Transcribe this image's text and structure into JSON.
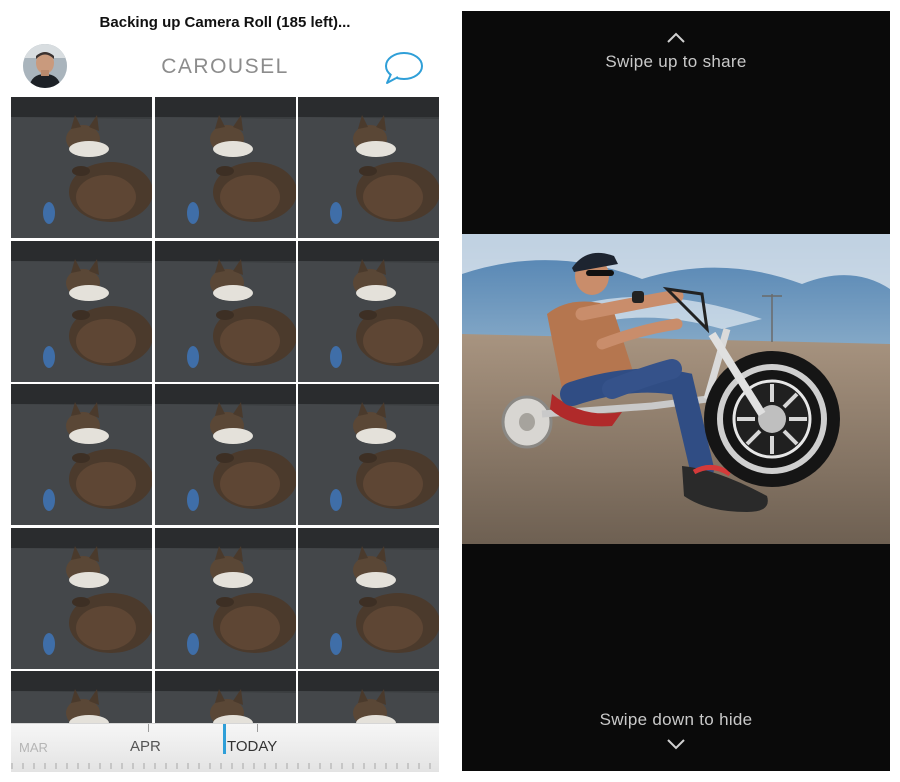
{
  "status": {
    "text": "Backing up Camera Roll (185 left)..."
  },
  "header": {
    "title": "CAROUSEL",
    "avatar_icon": "user-avatar",
    "messages_icon": "speech-bubble-icon",
    "accent": "#2f9fd8"
  },
  "grid": {
    "columns": 3,
    "visible_rows": 5,
    "photo_subject": "cat"
  },
  "timeline": {
    "labels": {
      "mar": "MAR",
      "apr": "APR",
      "today": "TODAY"
    },
    "cursor_color": "#2f9fd8"
  },
  "viewer": {
    "swipe_up": "Swipe up to share",
    "swipe_down": "Swipe down to hide",
    "chevron_up_icon": "chevron-up-icon",
    "chevron_down_icon": "chevron-down-icon"
  }
}
